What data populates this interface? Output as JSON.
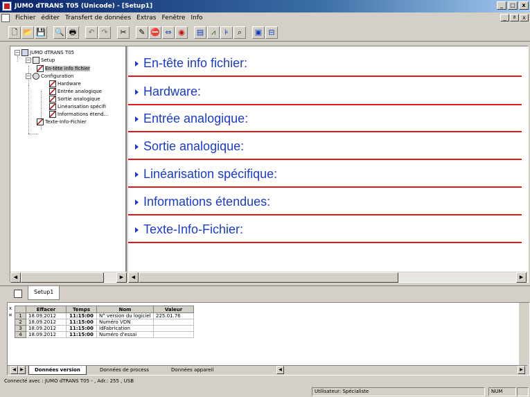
{
  "window": {
    "title": "JUMO dTRANS T05 (Unicode) - [Setup1]",
    "min": "_",
    "max": "□",
    "close": "x",
    "mdi_min": "_",
    "mdi_restore": "ª",
    "mdi_close": "x"
  },
  "menu": [
    "Fichier",
    "éditer",
    "Transfert de données",
    "Extras",
    "Fenêtre",
    "Info"
  ],
  "toolbar_icons": [
    "new-document-icon",
    "open-folder-icon",
    "save-icon",
    "print-preview-icon",
    "print-icon",
    "undo-icon",
    "redo-icon",
    "scissors-icon",
    "edit-icon",
    "stop-icon",
    "link-icon",
    "target-icon",
    "chart-icon",
    "graph-icon",
    "bookmark-icon",
    "search-icon",
    "window-icon",
    "split-window-icon"
  ],
  "tree": {
    "root": "JUMO dTRANS T05",
    "setup": "Setup",
    "header_info": "En-tête info fichier",
    "configuration": "Configuration",
    "hardware": "Hardware",
    "analog_in": "Entrée analogique",
    "analog_out": "Sortie analogique",
    "linearization": "Linéarisation spécifi",
    "extended_info": "Informations étend...",
    "text_info": "Texte-Info-Fichier"
  },
  "sections": [
    "En-tête info fichier:",
    "Hardware:",
    "Entrée analogique:",
    "Sortie analogique:",
    "Linéarisation spécifique:",
    "Informations étendues:",
    "Texte-Info-Fichier:"
  ],
  "doc_tab": "Setup1",
  "table": {
    "headers": [
      "Effacer",
      "Temps",
      "Nom",
      "Valeur"
    ],
    "rows": [
      {
        "n": "1",
        "date": "18.09.2012",
        "time": "11:15:00",
        "name": "N° version du logiciel",
        "value": "225.01.76"
      },
      {
        "n": "2",
        "date": "18.09.2012",
        "time": "11:15:00",
        "name": "Numéro VDN",
        "value": ""
      },
      {
        "n": "3",
        "date": "18.09.2012",
        "time": "11:15:00",
        "name": "IdFabrication",
        "value": ""
      },
      {
        "n": "4",
        "date": "18.09.2012",
        "time": "11:15:00",
        "name": "Numéro d'essai",
        "value": ""
      }
    ]
  },
  "bottom_tabs": [
    "Données version",
    "Données de process",
    "Données appareil"
  ],
  "status": {
    "connection": "Connecté avec : JUMO dTRANS T05 - , Adr.: 255 , USB",
    "user": "Utilisateur: Spécialiste",
    "num": "NUM"
  }
}
